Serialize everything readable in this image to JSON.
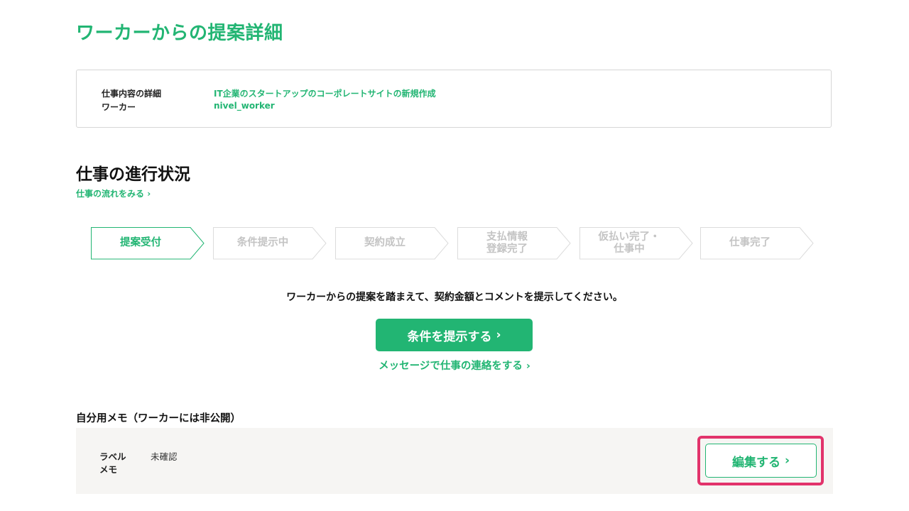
{
  "page_title": "ワーカーからの提案詳細",
  "info": {
    "job_label": "仕事内容の詳細",
    "job_value": "IT企業のスタートアップのコーポレートサイトの新規作成",
    "worker_label": "ワーカー",
    "worker_value": "nivel_worker"
  },
  "progress": {
    "title": "仕事の進行状況",
    "flow_link": "仕事の流れをみる",
    "steps": [
      {
        "label": "提案受付",
        "active": true
      },
      {
        "label": "条件提示中",
        "active": false
      },
      {
        "label": "契約成立",
        "active": false
      },
      {
        "label": "支払情報\n登録完了",
        "active": false
      },
      {
        "label": "仮払い完了・\n仕事中",
        "active": false
      },
      {
        "label": "仕事完了",
        "active": false
      }
    ]
  },
  "instruction": "ワーカーからの提案を踏まえて、契約金額とコメントを提示してください。",
  "actions": {
    "primary_label": "条件を提示する",
    "message_link": "メッセージで仕事の連絡をする"
  },
  "memo": {
    "title": "自分用メモ（ワーカーには非公開）",
    "label_key": "ラベル",
    "label_value": "未確認",
    "memo_key": "メモ",
    "memo_value": "",
    "edit_label": "編集する"
  },
  "colors": {
    "brand": "#22b573",
    "highlight": "#e2336b",
    "inactive": "#c4c4c4",
    "memo_bg": "#f6f5f3"
  },
  "icons": {
    "chevron": "chevron-right-icon"
  }
}
